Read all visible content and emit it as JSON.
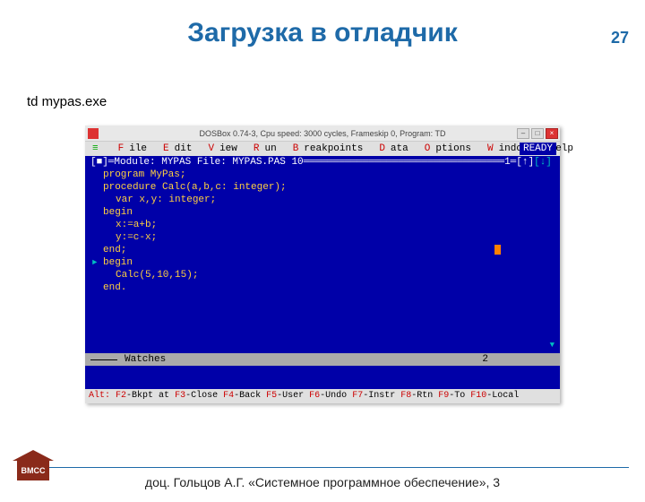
{
  "page": {
    "number": "27",
    "title": "Загрузка в отладчик",
    "command": "td mypas.exe"
  },
  "dosbox": {
    "title": "DOSBox 0.74-3, Cpu speed: 3000 cycles, Frameskip 0, Program: TD"
  },
  "menu": {
    "items": [
      {
        "hot": "F",
        "rest": "ile"
      },
      {
        "hot": "E",
        "rest": "dit"
      },
      {
        "hot": "V",
        "rest": "iew"
      },
      {
        "hot": "R",
        "rest": "un"
      },
      {
        "hot": "B",
        "rest": "reakpoints"
      },
      {
        "hot": "D",
        "rest": "ata"
      },
      {
        "hot": "O",
        "rest": "ptions"
      },
      {
        "hot": "W",
        "rest": "indow"
      },
      {
        "hot": "H",
        "rest": "elp"
      }
    ],
    "ready": "READY",
    "sys": "≡"
  },
  "module": {
    "label": "Module: MYPAS File: MYPAS.PAS 10",
    "right": "1═[↑]"
  },
  "code": [
    {
      "t": "program MyPas;",
      "i": 0
    },
    {
      "t": "",
      "i": 0
    },
    {
      "t": "procedure Calc(a,b,c: integer);",
      "i": 0
    },
    {
      "t": "var x,y: integer;",
      "i": 1
    },
    {
      "t": "begin",
      "i": 0
    },
    {
      "t": "x:=a+b;",
      "i": 1
    },
    {
      "t": "y:=c-x;",
      "i": 1
    },
    {
      "t": "end;",
      "i": 0,
      "cur": true
    },
    {
      "t": "",
      "i": 0
    },
    {
      "t": "begin",
      "i": 0,
      "arr": true
    },
    {
      "t": "Calc(5,10,15);",
      "i": 1
    },
    {
      "t": "end.",
      "i": 0
    }
  ],
  "watches": {
    "label": "Watches",
    "num": "2"
  },
  "status": {
    "alt": "Alt:",
    "keys": [
      {
        "k": "F2",
        "l": "-Bkpt at"
      },
      {
        "k": "F3",
        "l": "-Close"
      },
      {
        "k": "F4",
        "l": "-Back"
      },
      {
        "k": "F5",
        "l": "-User"
      },
      {
        "k": "F6",
        "l": "-Undo"
      },
      {
        "k": "F7",
        "l": "-Instr"
      },
      {
        "k": "F8",
        "l": "-Rtn"
      },
      {
        "k": "F9",
        "l": "-To"
      },
      {
        "k": "F10",
        "l": "-Local"
      }
    ]
  },
  "footer": {
    "text": "доц. Гольцов А.Г.  «Системное программное обеспечение», 3",
    "logo": "ВМСС"
  }
}
